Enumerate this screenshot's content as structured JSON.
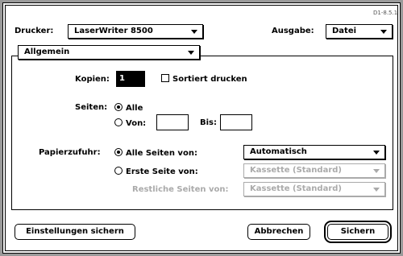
{
  "version": "D1-8.5.1",
  "printer": {
    "label": "Drucker:",
    "value": "LaserWriter 8500"
  },
  "output": {
    "label": "Ausgabe:",
    "value": "Datei"
  },
  "section": {
    "value": "Allgemein"
  },
  "copies": {
    "label": "Kopien:",
    "value": "1"
  },
  "collate": {
    "label": "Sortiert drucken",
    "checked": false
  },
  "pages": {
    "label": "Seiten:",
    "all_label": "Alle",
    "from_label": "Von:",
    "to_label": "Bis:",
    "from_value": "",
    "to_value": ""
  },
  "paper": {
    "label": "Papierzufuhr:",
    "all_pages_label": "Alle Seiten von:",
    "all_pages_value": "Automatisch",
    "first_page_label": "Erste Seite von:",
    "first_page_value": "Kassette (Standard)",
    "remaining_label": "Restliche Seiten von:",
    "remaining_value": "Kassette (Standard)"
  },
  "buttons": {
    "save_settings": "Einstellungen sichern",
    "cancel": "Abbrechen",
    "save": "Sichern"
  }
}
